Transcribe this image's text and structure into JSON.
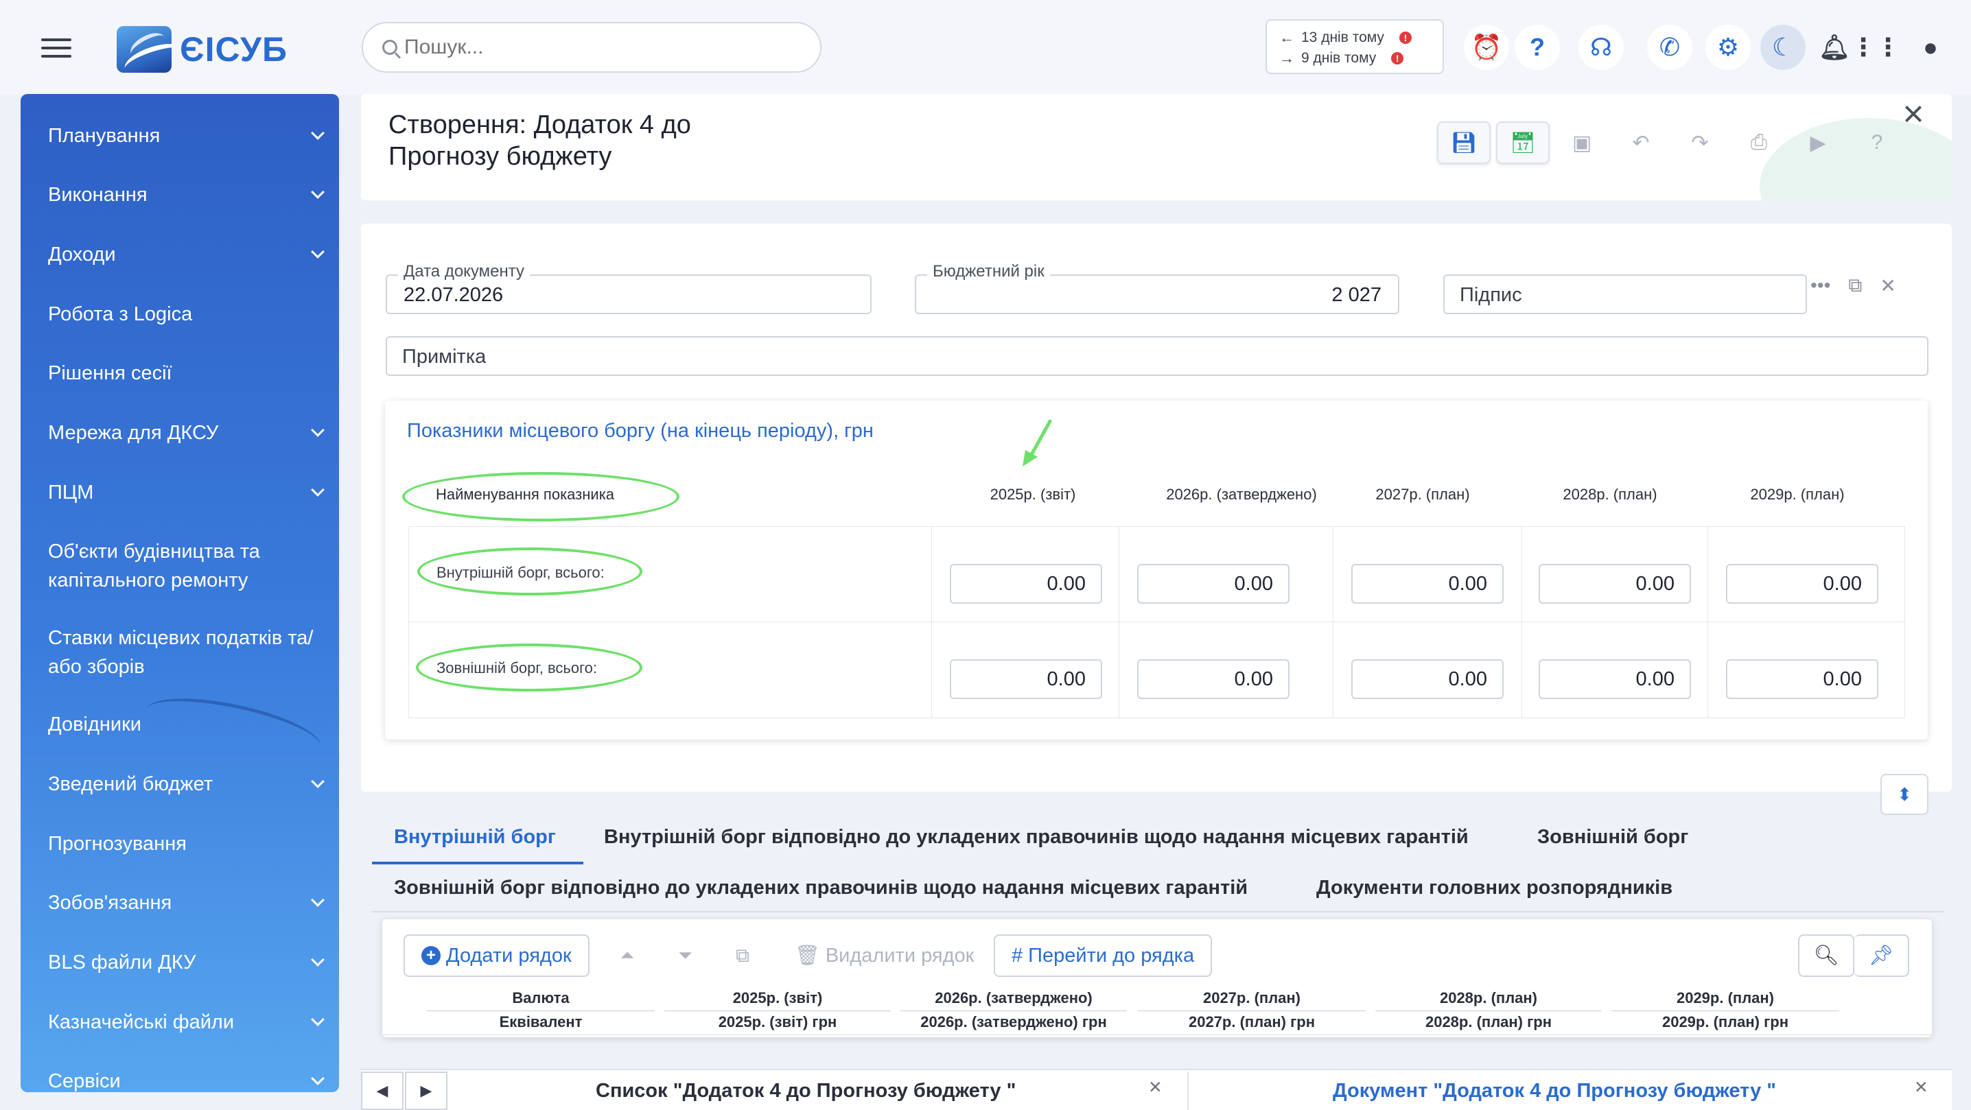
{
  "app": {
    "name": "ЄІСУБ"
  },
  "search": {
    "placeholder": "Пошук..."
  },
  "sync": {
    "line1": "13 днів тому",
    "line2": "9 днів тому"
  },
  "sidebar": {
    "items": [
      {
        "label": "Планування",
        "expandable": true
      },
      {
        "label": "Виконання",
        "expandable": true
      },
      {
        "label": "Доходи",
        "expandable": true
      },
      {
        "label": "Робота з Logica",
        "expandable": false
      },
      {
        "label": "Рішення сесії",
        "expandable": false
      },
      {
        "label": "Мережа для ДКСУ",
        "expandable": true
      },
      {
        "label": "ПЦМ",
        "expandable": true
      },
      {
        "label": "Об'єкти будівництва та капітального ремонту",
        "expandable": false
      },
      {
        "label": "Ставки місцевих податків та/або зборів",
        "expandable": false
      },
      {
        "label": "Довідники",
        "expandable": false
      },
      {
        "label": "Зведений бюджет",
        "expandable": true
      },
      {
        "label": "Прогнозування",
        "expandable": false
      },
      {
        "label": "Зобов'язання",
        "expandable": true
      },
      {
        "label": "BLS файли ДКУ",
        "expandable": true
      },
      {
        "label": "Казначейські файли",
        "expandable": true
      },
      {
        "label": "Сервіси",
        "expandable": true
      }
    ]
  },
  "header": {
    "title": "Створення: Додаток 4 до Прогнозу бюджету"
  },
  "form": {
    "doc_date_label": "Дата документу",
    "doc_date_value": "22.07.2026",
    "budget_year_label": "Бюджетний рік",
    "budget_year_value": "2 027",
    "sign_placeholder": "Підпис",
    "note_placeholder": "Примітка"
  },
  "debt": {
    "title": "Показники місцевого боргу (на кінець періоду), грн",
    "name_header": "Найменування показника",
    "columns": [
      "2025р. (звіт)",
      "2026р. (затверджено)",
      "2027р. (план)",
      "2028р. (план)",
      "2029р. (план)"
    ],
    "rows": [
      {
        "label": "Внутрішній борг, всього:",
        "values": [
          "0.00",
          "0.00",
          "0.00",
          "0.00",
          "0.00"
        ]
      },
      {
        "label": "Зовнішній борг, всього:",
        "values": [
          "0.00",
          "0.00",
          "0.00",
          "0.00",
          "0.00"
        ]
      }
    ]
  },
  "tabs": [
    "Внутрішній борг",
    "Внутрішній борг відповідно до укладених правочинів щодо надання місцевих гарантій",
    "Зовнішній борг",
    "Зовнішній борг відповідно до укладених правочинів щодо надання місцевих гарантій",
    "Документи головних розпорядників"
  ],
  "grid": {
    "add_row": "Додати рядок",
    "delete_row": "Видалити рядок",
    "goto_row": "Перейти до рядка",
    "head1": [
      "Валюта",
      "2025р.  (звіт)",
      "2026р.  (затверджено)",
      "2027р.  (план)",
      "2028р.  (план)",
      "2029р.  (план)"
    ],
    "head2": [
      "Еквівалент",
      "2025р.  (звіт) грн",
      "2026р.  (затверджено) грн",
      "2027р.  (план) грн",
      "2028р.  (план) грн",
      "2029р.  (план) грн"
    ]
  },
  "taskbar": {
    "task1": "Список \"Додаток 4 до Прогнозу бюджету \"",
    "task2": "Документ \"Додаток 4 до Прогнозу бюджету \""
  },
  "colors": {
    "accent": "#2a6bcf",
    "annotation": "#6ee06a",
    "sidebar_top": "#2e5fc4",
    "sidebar_bottom": "#58a6ef"
  }
}
